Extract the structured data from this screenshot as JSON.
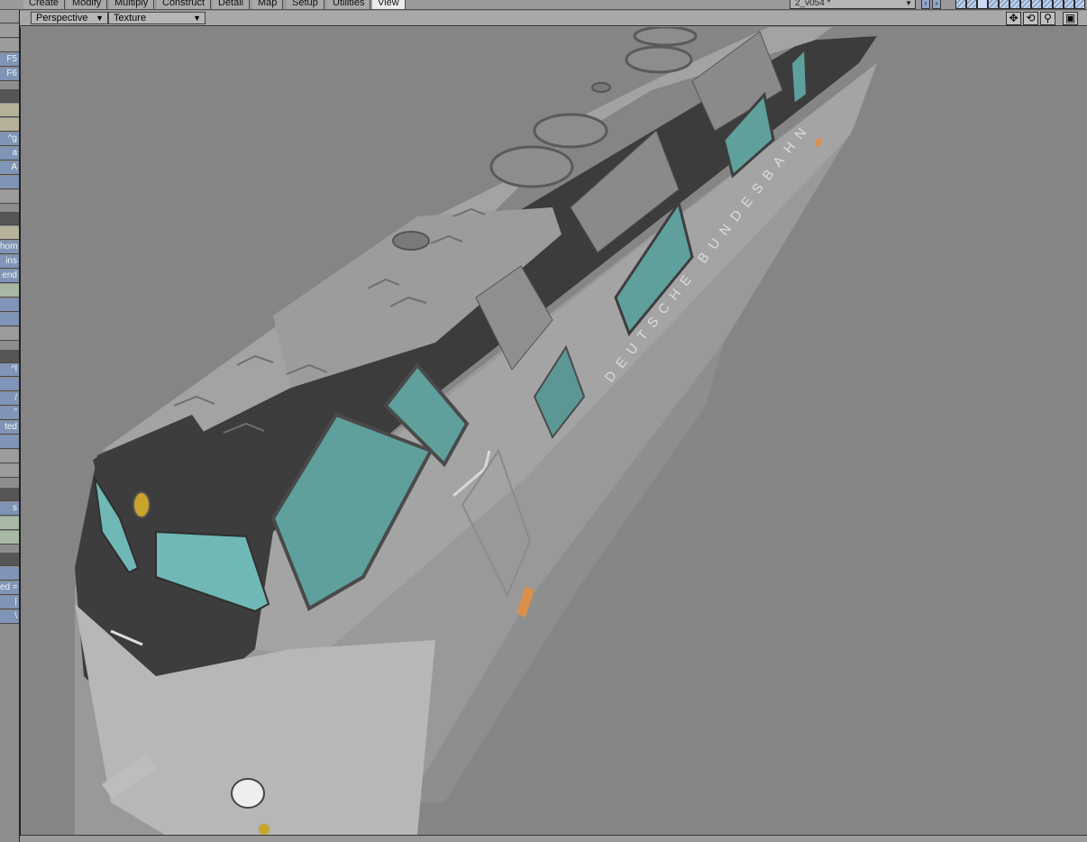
{
  "menu_tabs": [
    "Create",
    "Modify",
    "Multiply",
    "Construct",
    "Detail",
    "Map",
    "Setup",
    "Utilities",
    "View"
  ],
  "active_tab": "View",
  "scene_select": {
    "value": "2_v054 *"
  },
  "viewport": {
    "view_mode": "Perspective",
    "render_mode": "Texture",
    "tools": {
      "move": "✥",
      "rotate": "⟲",
      "zoom": "⚲",
      "maximize": "▣"
    }
  },
  "left_toolbar": [
    {
      "label": "",
      "style": "gray"
    },
    {
      "label": "",
      "style": "gray"
    },
    {
      "label": "",
      "style": "gray"
    },
    {
      "label": "F5",
      "style": "blue"
    },
    {
      "label": "F6",
      "style": "blue"
    },
    {
      "label": "",
      "style": "dark"
    },
    {
      "label": "",
      "style": "khaki"
    },
    {
      "label": "",
      "style": "khaki"
    },
    {
      "label": "^g",
      "style": "blue"
    },
    {
      "label": "a",
      "style": "blue"
    },
    {
      "label": "A",
      "style": "blue"
    },
    {
      "label": "",
      "style": "blue"
    },
    {
      "label": "",
      "style": "gray"
    },
    {
      "label": "",
      "style": "dark"
    },
    {
      "label": "",
      "style": "khaki"
    },
    {
      "label": "hom",
      "style": "blue"
    },
    {
      "label": "ins",
      "style": "blue"
    },
    {
      "label": "end",
      "style": "blue"
    },
    {
      "label": "",
      "style": "mint"
    },
    {
      "label": "",
      "style": "blue"
    },
    {
      "label": "",
      "style": "blue"
    },
    {
      "label": "",
      "style": "gray"
    },
    {
      "label": "",
      "style": "dark"
    },
    {
      "label": "^l",
      "style": "blue"
    },
    {
      "label": "",
      "style": "blue"
    },
    {
      "label": "/",
      "style": "blue"
    },
    {
      "label": "''",
      "style": "blue"
    },
    {
      "label": "ted",
      "style": "blue"
    },
    {
      "label": "",
      "style": "blue"
    },
    {
      "label": "",
      "style": "gray"
    },
    {
      "label": "",
      "style": "gray"
    },
    {
      "label": "",
      "style": "dark"
    },
    {
      "label": "s",
      "style": "blue"
    },
    {
      "label": "",
      "style": "mint"
    },
    {
      "label": "",
      "style": "mint"
    },
    {
      "label": "",
      "style": "dark"
    },
    {
      "label": "",
      "style": "blue"
    },
    {
      "label": "ed =",
      "style": "blue"
    },
    {
      "label": "|",
      "style": "blue"
    },
    {
      "label": "\\",
      "style": "blue"
    }
  ],
  "model": {
    "livery_text": "DEUTSCHE BUNDESBAHN",
    "colors": {
      "body": "#a9a9a9",
      "roof_dark": "#3d3d3d",
      "glass": "#6fb8b5",
      "background": "#858585",
      "lamp": "#c9a42c",
      "marker": "#d9904a"
    }
  }
}
